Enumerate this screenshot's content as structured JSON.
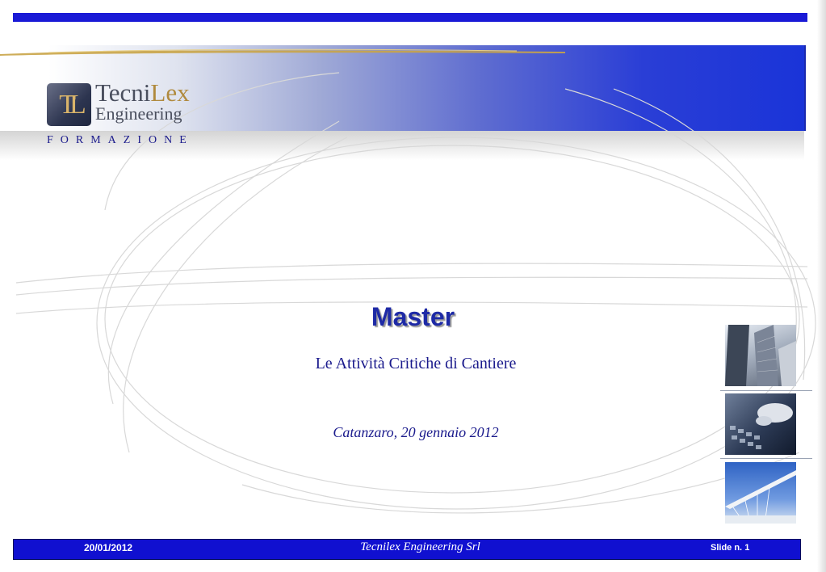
{
  "logo": {
    "monogram": "TL",
    "name_part1": "Tecni",
    "name_part2": "Lex",
    "name_line2": "Engineering"
  },
  "tagline": "FORMAZIONE",
  "slide": {
    "title": "Master",
    "subtitle": "Le Attività Critiche di Cantiere",
    "place_date": "Catanzaro, 20 gennaio 2012"
  },
  "footer": {
    "date": "20/01/2012",
    "company": "Tecnilex Engineering Srl",
    "slide_label": "Slide n.",
    "slide_number": "1"
  },
  "colors": {
    "accent_blue": "#1a1ad6",
    "text_blue": "#1a1a8c",
    "gold": "#b08a3e"
  },
  "photos": [
    "skyscrapers-photo",
    "keyboard-typing-photo",
    "white-bridge-photo"
  ]
}
